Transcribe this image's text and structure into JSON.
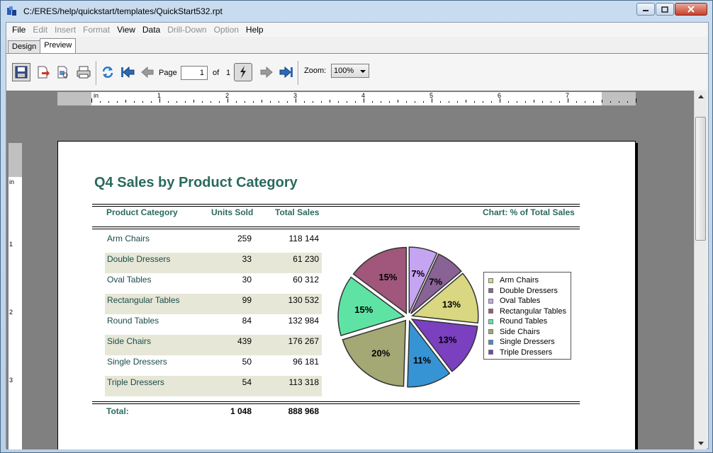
{
  "window": {
    "title": "C:/ERES/help/quickstart/templates/QuickStart532.rpt"
  },
  "menu": [
    {
      "label": "File",
      "enabled": true
    },
    {
      "label": "Edit",
      "enabled": false
    },
    {
      "label": "Insert",
      "enabled": false
    },
    {
      "label": "Format",
      "enabled": false
    },
    {
      "label": "View",
      "enabled": true
    },
    {
      "label": "Data",
      "enabled": true
    },
    {
      "label": "Drill-Down",
      "enabled": false
    },
    {
      "label": "Option",
      "enabled": false
    },
    {
      "label": "Help",
      "enabled": true
    }
  ],
  "tabs": {
    "design": "Design",
    "preview": "Preview",
    "active": "Preview"
  },
  "toolbar": {
    "page_label": "Page",
    "page_value": "1",
    "of_label": "of",
    "total_pages": "1",
    "zoom_label": "Zoom:",
    "zoom_value": "100%"
  },
  "ruler": {
    "unit": "in",
    "h_marks": [
      "1",
      "2",
      "3",
      "4",
      "5",
      "6",
      "7"
    ],
    "v_marks": [
      "1",
      "2",
      "3"
    ]
  },
  "report": {
    "title": "Q4 Sales by Product Category",
    "headers": {
      "category": "Product Category",
      "units": "Units Sold",
      "sales": "Total Sales",
      "chart": "Chart: % of Total Sales"
    },
    "rows": [
      {
        "category": "Arm Chairs",
        "units": "259",
        "sales": "118 144"
      },
      {
        "category": "Double Dressers",
        "units": "33",
        "sales": "61 230"
      },
      {
        "category": "Oval Tables",
        "units": "30",
        "sales": "60 312"
      },
      {
        "category": "Rectangular Tables",
        "units": "99",
        "sales": "130 532"
      },
      {
        "category": "Round Tables",
        "units": "84",
        "sales": "132 984"
      },
      {
        "category": "Side Chairs",
        "units": "439",
        "sales": "176 267"
      },
      {
        "category": "Single Dressers",
        "units": "50",
        "sales": "96 181"
      },
      {
        "category": "Triple Dressers",
        "units": "54",
        "sales": "113 318"
      }
    ],
    "total": {
      "label": "Total:",
      "units": "1 048",
      "sales": "888 968"
    }
  },
  "chart_data": {
    "type": "pie",
    "title": "",
    "categories": [
      "Arm Chairs",
      "Double Dressers",
      "Oval Tables",
      "Rectangular Tables",
      "Round Tables",
      "Side Chairs",
      "Single Dressers",
      "Triple Dressers"
    ],
    "values": [
      13,
      7,
      7,
      15,
      15,
      20,
      11,
      13
    ],
    "value_labels": [
      "13%",
      "7%",
      "7%",
      "15%",
      "15%",
      "20%",
      "11%",
      "13%"
    ],
    "colors": [
      "#d9d781",
      "#8a6396",
      "#c5a5f2",
      "#a0577b",
      "#5fe3a4",
      "#a3a874",
      "#3794d4",
      "#7a40c0"
    ],
    "legend": "right",
    "exploded": true
  }
}
